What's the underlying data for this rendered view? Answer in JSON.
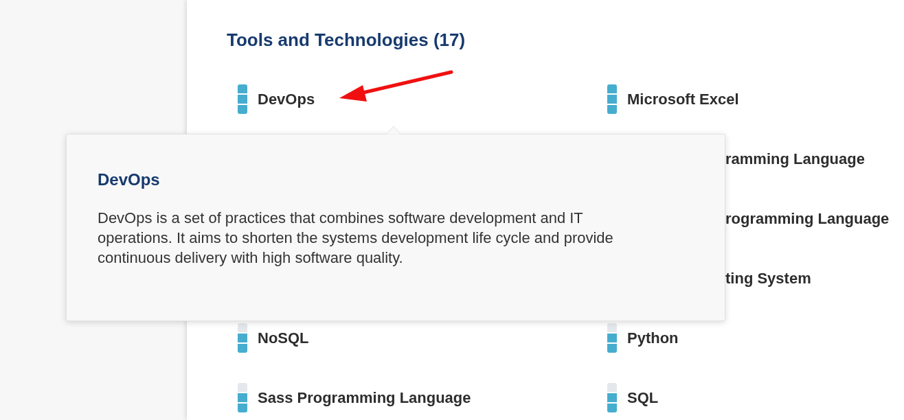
{
  "section": {
    "title": "Tools and Technologies (17)"
  },
  "rows": [
    {
      "left": {
        "kind": "full",
        "name": "DevOps",
        "level": 1
      },
      "right": {
        "kind": "full",
        "name": "Microsoft Excel",
        "level": 1
      }
    },
    {
      "right": {
        "kind": "cut",
        "name": "ramming Language"
      }
    },
    {
      "right": {
        "kind": "cut",
        "name": "rogramming Language"
      }
    },
    {
      "right": {
        "kind": "cut",
        "name": "ting System"
      }
    },
    {
      "left": {
        "kind": "full",
        "name": "NoSQL",
        "level": 0.67
      },
      "right": {
        "kind": "full",
        "name": "Python",
        "level": 0.67
      }
    },
    {
      "left": {
        "kind": "full",
        "name": "Sass Programming Language",
        "level": 0.67
      },
      "right": {
        "kind": "full",
        "name": "SQL",
        "level": 0.67
      }
    }
  ],
  "tooltip": {
    "title": "DevOps",
    "text": "DevOps is a set of practices that combines software development and IT operations. It aims to shorten the systems development life cycle and provide continuous delivery with high software quality."
  }
}
